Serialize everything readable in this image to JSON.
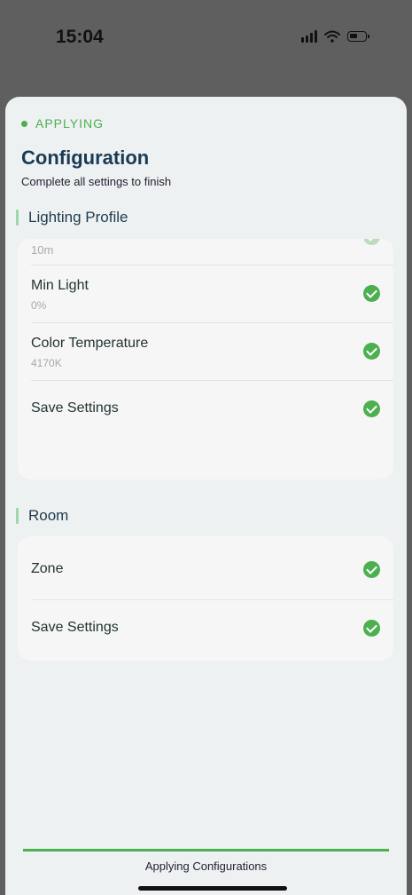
{
  "status_bar": {
    "time": "15:04",
    "icons": [
      "signal-icon",
      "wifi-icon",
      "battery-icon"
    ]
  },
  "sheet": {
    "state_label": "APPLYING",
    "title": "Configuration",
    "subtitle": "Complete all settings to finish"
  },
  "sections": [
    {
      "title": "Lighting Profile",
      "items": [
        {
          "label": "",
          "value": "10m",
          "status": "done"
        },
        {
          "label": "Min Light",
          "value": "0%",
          "status": "done"
        },
        {
          "label": "Color Temperature",
          "value": "4170K",
          "status": "done"
        },
        {
          "label": "Save Settings",
          "value": "",
          "status": "done"
        }
      ]
    },
    {
      "title": "Room",
      "items": [
        {
          "label": "Zone",
          "value": "",
          "status": "done"
        },
        {
          "label": "Save Settings",
          "value": "",
          "status": "done"
        }
      ]
    }
  ],
  "footer": {
    "progress": 1.0,
    "text": "Applying Configurations"
  },
  "colors": {
    "accent_green": "#4caf50",
    "section_bar": "#9bd7a8",
    "title_navy": "#193b55"
  }
}
